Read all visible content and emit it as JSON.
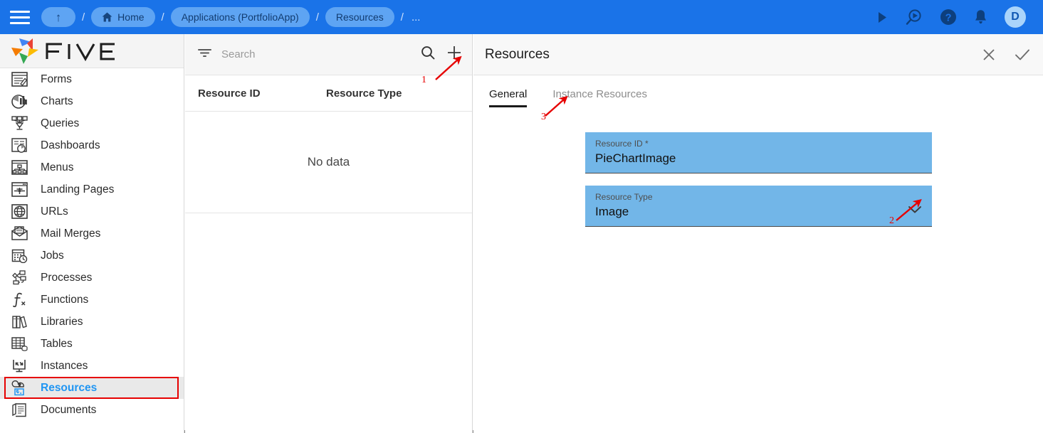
{
  "topbar": {
    "menu_icon": "hamburger-icon",
    "up_icon": "arrow-up-icon",
    "breadcrumbs": [
      {
        "label": "Home",
        "icon": "home-icon"
      },
      {
        "label": "Applications (PortfolioApp)",
        "icon": ""
      },
      {
        "label": "Resources",
        "icon": ""
      }
    ],
    "separator": "/",
    "overflow": "...",
    "right_icons": [
      "play-icon",
      "search-run-icon",
      "help-icon",
      "notifications-bell-icon"
    ],
    "avatar_initial": "D"
  },
  "sidebar": {
    "brand": "FIVE",
    "items": [
      {
        "label": "Forms",
        "icon": "forms-icon"
      },
      {
        "label": "Charts",
        "icon": "charts-icon"
      },
      {
        "label": "Queries",
        "icon": "queries-icon"
      },
      {
        "label": "Dashboards",
        "icon": "dashboards-icon"
      },
      {
        "label": "Menus",
        "icon": "menus-icon"
      },
      {
        "label": "Landing Pages",
        "icon": "landing-pages-icon"
      },
      {
        "label": "URLs",
        "icon": "urls-icon"
      },
      {
        "label": "Mail Merges",
        "icon": "mail-merges-icon"
      },
      {
        "label": "Jobs",
        "icon": "jobs-icon"
      },
      {
        "label": "Processes",
        "icon": "processes-icon"
      },
      {
        "label": "Functions",
        "icon": "functions-icon"
      },
      {
        "label": "Libraries",
        "icon": "libraries-icon"
      },
      {
        "label": "Tables",
        "icon": "tables-icon"
      },
      {
        "label": "Instances",
        "icon": "instances-icon"
      },
      {
        "label": "Resources",
        "icon": "resources-icon"
      },
      {
        "label": "Documents",
        "icon": "documents-icon"
      }
    ],
    "active_label": "Resources",
    "active_color": "#2196f3",
    "highlight_color": "#e60000"
  },
  "list_panel": {
    "search_placeholder": "Search",
    "search_value": "",
    "filter_icon": "filter-icon",
    "search_icon": "search-icon",
    "add_icon": "plus-icon",
    "columns": [
      "Resource ID",
      "Resource Type"
    ],
    "rows": [],
    "empty_message": "No data"
  },
  "detail": {
    "title": "Resources",
    "close_icon": "close-icon",
    "confirm_icon": "check-icon",
    "tabs": [
      {
        "label": "General",
        "selected": true
      },
      {
        "label": "Instance Resources",
        "selected": false
      }
    ],
    "fields": [
      {
        "label": "Resource ID *",
        "value": "PieChartImage",
        "type": "text",
        "highlight": "#72b6e8"
      },
      {
        "label": "Resource Type",
        "value": "Image",
        "type": "select",
        "chevron_icon": "chevron-down-icon",
        "highlight": "#72b6e8"
      }
    ]
  },
  "annotations": {
    "color": "#e60000",
    "markers": [
      {
        "number": "1",
        "target": "plus-icon"
      },
      {
        "number": "2",
        "target": "resource-type-chevron"
      },
      {
        "number": "3",
        "target": "instance-resources-tab"
      }
    ]
  }
}
